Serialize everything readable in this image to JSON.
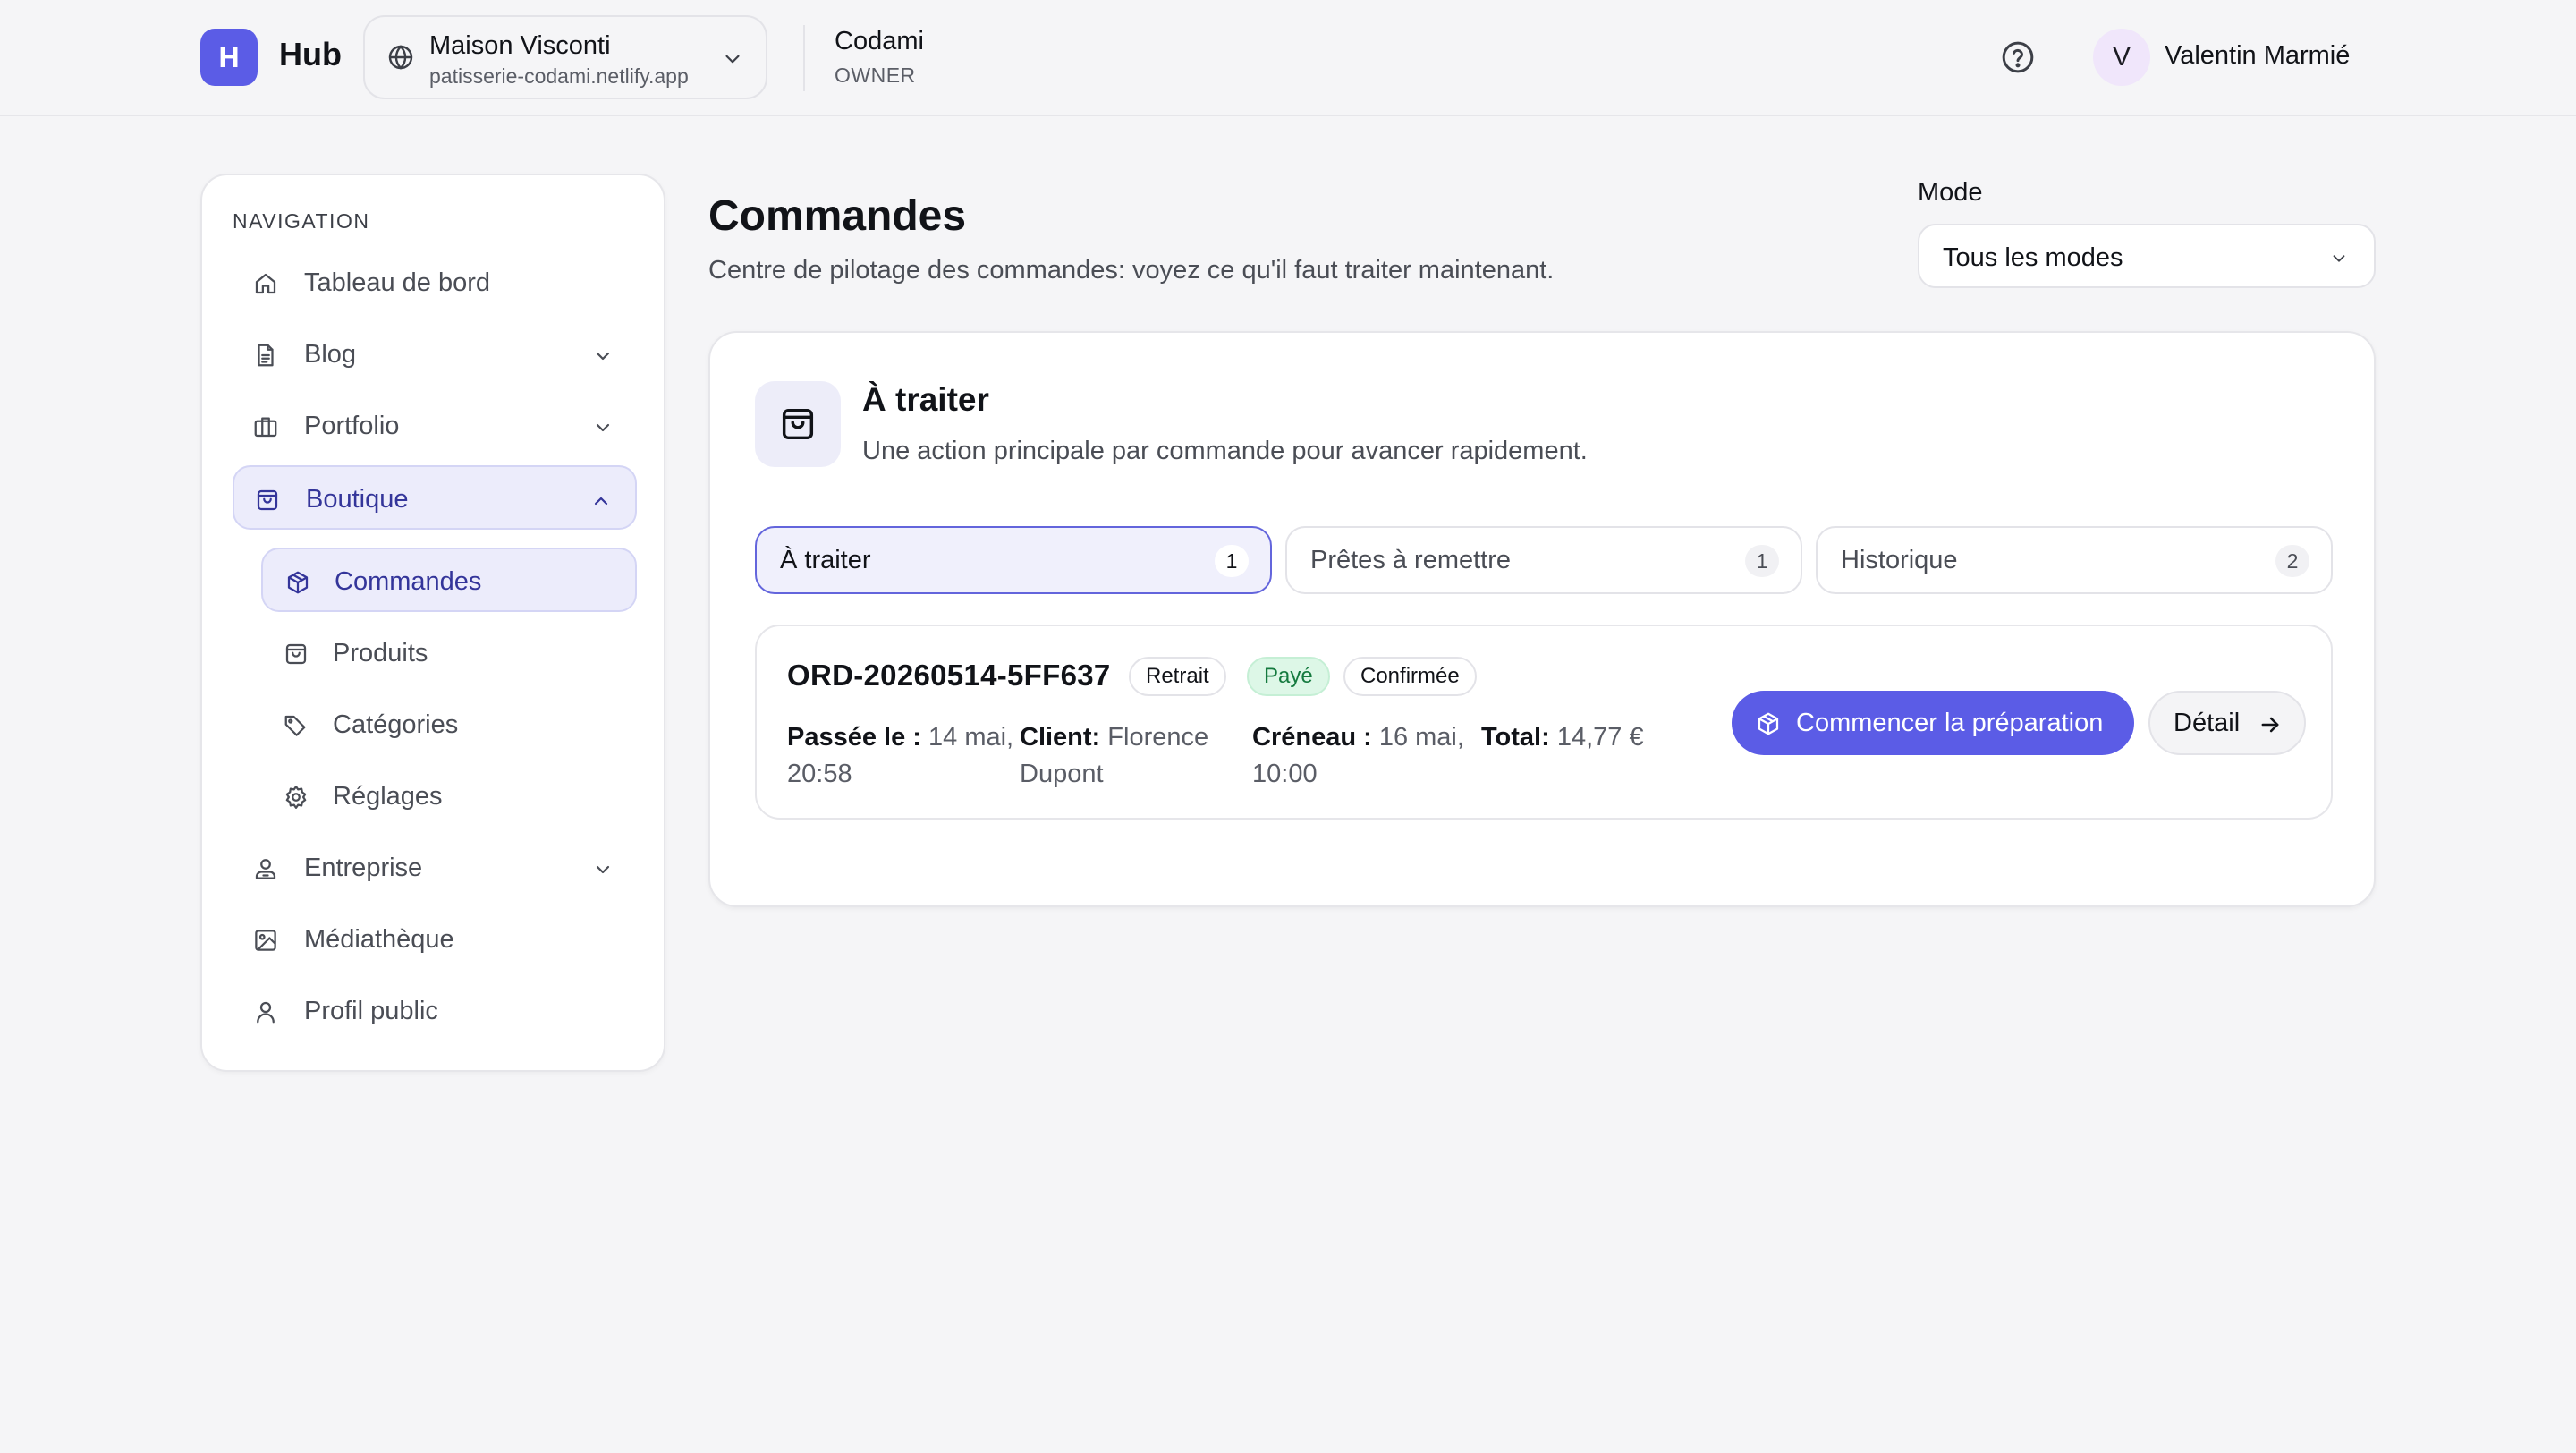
{
  "header": {
    "logo_letter": "H",
    "app_name": "Hub",
    "site": {
      "name": "Maison Visconti",
      "url": "patisserie-codami.netlify.app"
    },
    "org": {
      "name": "Codami",
      "role": "OWNER"
    },
    "user": {
      "initial": "V",
      "name": "Valentin Marmié"
    }
  },
  "sidebar": {
    "heading": "NAVIGATION",
    "items": {
      "dashboard": "Tableau de bord",
      "blog": "Blog",
      "portfolio": "Portfolio",
      "boutique": "Boutique",
      "entreprise": "Entreprise",
      "mediatheque": "Médiathèque",
      "profil": "Profil public"
    },
    "boutique_children": {
      "commandes": "Commandes",
      "produits": "Produits",
      "categories": "Catégories",
      "reglages": "Réglages"
    }
  },
  "main": {
    "title": "Commandes",
    "subtitle": "Centre de pilotage des commandes: voyez ce qu'il faut traiter maintenant.",
    "mode": {
      "label": "Mode",
      "value": "Tous les modes"
    },
    "panel": {
      "title": "À traiter",
      "subtitle": "Une action principale par commande pour avancer rapidement.",
      "tabs": [
        {
          "label": "À traiter",
          "count": "1"
        },
        {
          "label": "Prêtes à remettre",
          "count": "1"
        },
        {
          "label": "Historique",
          "count": "2"
        }
      ],
      "order": {
        "id": "ORD-20260514-5FF637",
        "badges": {
          "type": "Retrait",
          "payment": "Payé",
          "status": "Confirmée"
        },
        "placed": {
          "label": "Passée le :",
          "line1": "14 mai,",
          "line2": "20:58"
        },
        "client": {
          "label": "Client:",
          "line1": "Florence",
          "line2": "Dupont"
        },
        "slot": {
          "label": "Créneau :",
          "line1": "16 mai,",
          "line2": "10:00"
        },
        "total": {
          "label": "Total:",
          "value": "14,77 €"
        },
        "primary_action": "Commencer la préparation",
        "secondary_action": "Détail"
      }
    }
  },
  "colors": {
    "accent": "#5b5ce6",
    "accent_soft": "#ececfb",
    "paid_bg": "#ddf7e7",
    "paid_text": "#157a3f"
  }
}
